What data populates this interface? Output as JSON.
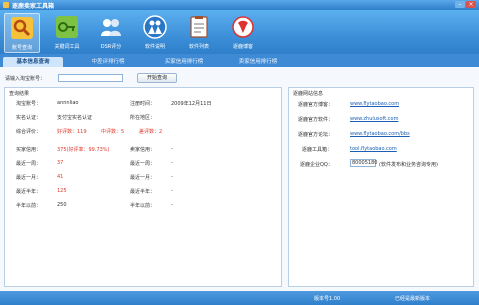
{
  "window": {
    "title": "逐鹿卖家工具箱"
  },
  "toolbar": {
    "items": [
      {
        "label": "账号查询"
      },
      {
        "label": "关键词工具"
      },
      {
        "label": "DSR评分"
      },
      {
        "label": "软件说明"
      },
      {
        "label": "软件列表"
      },
      {
        "label": "逐鹿博客"
      }
    ]
  },
  "tabs": [
    {
      "label": "基本信息查询"
    },
    {
      "label": "中差评排行榜"
    },
    {
      "label": "买家信用排行榜"
    },
    {
      "label": "卖家信用排行榜"
    }
  ],
  "query": {
    "label": "请输入淘宝账号：",
    "value": "",
    "button": "开始查询"
  },
  "result": {
    "title": "查询结果",
    "account_label": "淘宝账号：",
    "account_value": "annnliao",
    "reg_time_label": "注册时间：",
    "reg_time_value": "2009年12月11日",
    "cert_label": "实名认证：",
    "cert_value": "支付宝实名认证",
    "region_label": "所在地区：",
    "region_value": "",
    "overall_label": "综合评价：",
    "good_text": "好评数：119",
    "neutral_text": "中评数：5",
    "bad_text": "差评数：2",
    "buyer_credit_label": "买家信用：",
    "buyer_credit_value": "375(好评率：99.73%)",
    "seller_credit_label": "卖家信用：",
    "seller_credit_value": "-",
    "week_label": "最近一周：",
    "week_value": "37",
    "week_seller": "-",
    "month_label": "最近一月：",
    "month_value": "41",
    "month_seller": "-",
    "half_year_label": "最近半年：",
    "half_year_value": "125",
    "half_year_seller": "-",
    "before_half_year_label": "半年以前：",
    "before_half_year_value": "250",
    "before_half_year_seller": "-"
  },
  "site_info": {
    "title": "逐鹿网站信息",
    "blog_label": "逐鹿官方博客：",
    "blog_url": "www.flytaobao.com",
    "software_label": "逐鹿官方软件：",
    "software_url": "www.zhulusoft.com",
    "forum_label": "逐鹿官方论坛：",
    "forum_url": "www.flytaobao.com/bbs",
    "tools_label": "逐鹿工具箱：",
    "tools_url": "tool.flytaobao.com",
    "qq_label": "逐鹿企业QQ：",
    "qq_value": "80005180",
    "qq_note": "(软件发布和业务咨询专用)"
  },
  "status": {
    "version": "版本号1.00",
    "state": "已经是最新版本"
  }
}
